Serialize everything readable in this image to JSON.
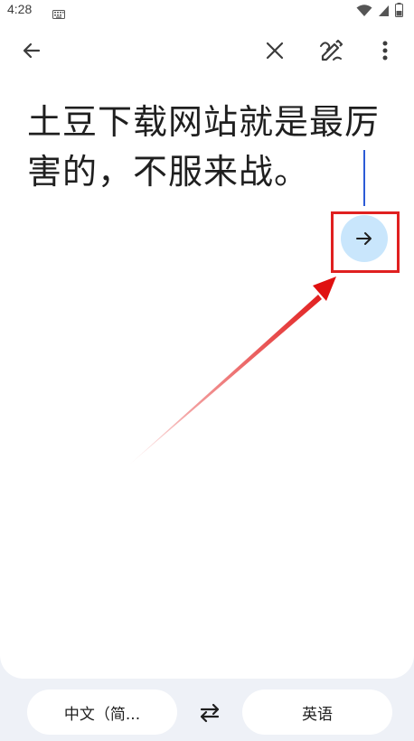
{
  "status_bar": {
    "time": "4:28",
    "icons": [
      "keyboard-icon",
      "wifi-icon",
      "cellular-icon",
      "battery-icon"
    ]
  },
  "toolbar": {
    "icons": [
      "back-arrow-icon",
      "clear-icon",
      "handwriting-icon",
      "more-vert-icon"
    ]
  },
  "editor": {
    "source_text": "土豆下载网站就是最厉害的，不服来战。",
    "translate_button_icon": "arrow-right-icon"
  },
  "languages": {
    "source": "中文（简...",
    "target": "英语",
    "swap_icon": "swap-icon"
  },
  "colors": {
    "accent": "#2c5bd6",
    "translate_button_bg": "#c9e6fc",
    "annotation_red": "#e02020",
    "surface": "#ffffff",
    "background": "#eef1f7"
  }
}
